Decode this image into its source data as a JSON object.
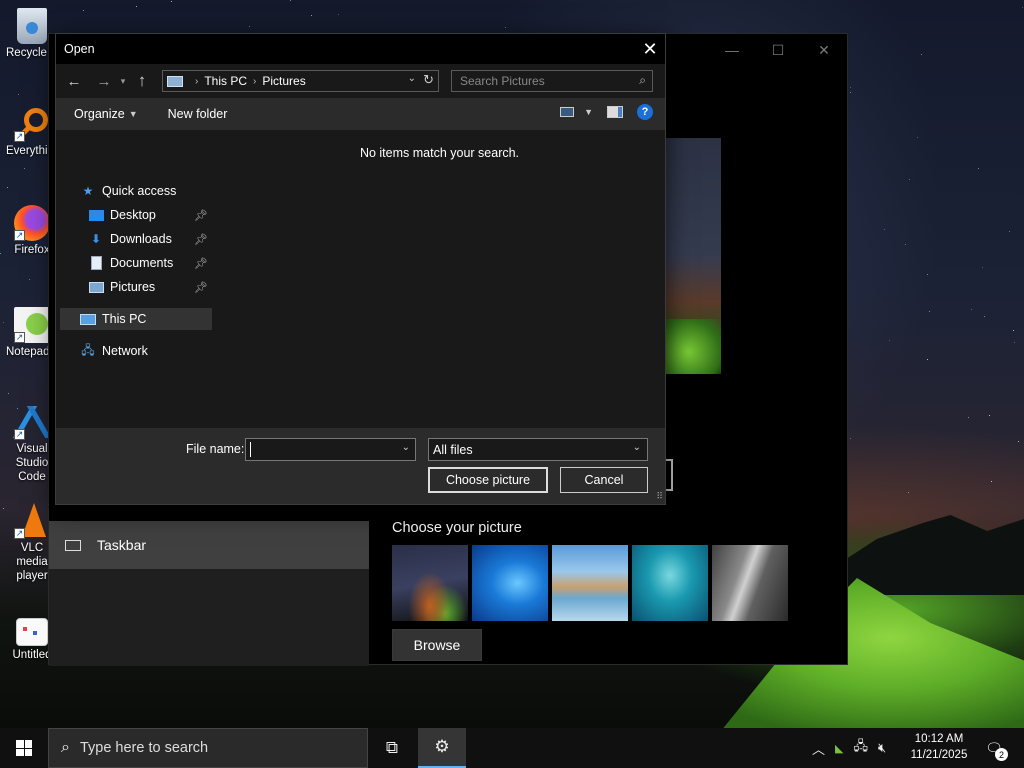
{
  "desktop": {
    "icons": [
      {
        "label": "Recycle Bin",
        "icon": "recycle-bin-icon"
      },
      {
        "label": "Everything",
        "icon": "everything-search-icon"
      },
      {
        "label": "Firefox",
        "icon": "firefox-icon"
      },
      {
        "label": "Notepad++",
        "icon": "notepad-plus-plus-icon"
      },
      {
        "label": "Visual Studio Code",
        "icon": "vscode-icon"
      },
      {
        "label": "VLC media player",
        "icon": "vlc-icon"
      },
      {
        "label": "Untitled",
        "icon": "paint-file-icon"
      }
    ]
  },
  "settings_window": {
    "minimize": "—",
    "maximize": "☐",
    "close": "✕",
    "nav_item": "Taskbar",
    "choose_picture_label": "Choose your picture",
    "browse_label": "Browse",
    "thumbnails": [
      "night-sky-tent",
      "windows-blue",
      "beach-rock",
      "underwater-swimmer",
      "rock-cliff"
    ]
  },
  "open_dialog": {
    "title": "Open",
    "close": "✕",
    "breadcrumb": [
      "This PC",
      "Pictures"
    ],
    "search_placeholder": "Search Pictures",
    "toolbar": {
      "organize": "Organize",
      "new_folder": "New folder",
      "help": "?"
    },
    "nav": [
      {
        "label": "Quick access",
        "icon": "star-icon",
        "pinned": false
      },
      {
        "label": "Desktop",
        "icon": "desktop-folder-icon",
        "pinned": true
      },
      {
        "label": "Downloads",
        "icon": "downloads-icon",
        "pinned": true
      },
      {
        "label": "Documents",
        "icon": "documents-icon",
        "pinned": true
      },
      {
        "label": "Pictures",
        "icon": "pictures-icon",
        "pinned": true
      },
      {
        "label": "This PC",
        "icon": "computer-icon",
        "selected": true
      },
      {
        "label": "Network",
        "icon": "network-icon"
      }
    ],
    "empty_message": "No items match your search.",
    "file_name_label": "File name:",
    "file_name_value": "",
    "file_type_value": "All files",
    "choose_button": "Choose picture",
    "cancel_button": "Cancel"
  },
  "taskbar": {
    "search_placeholder": "Type here to search",
    "time": "10:12 AM",
    "date": "11/21/2025",
    "notification_count": "2"
  }
}
